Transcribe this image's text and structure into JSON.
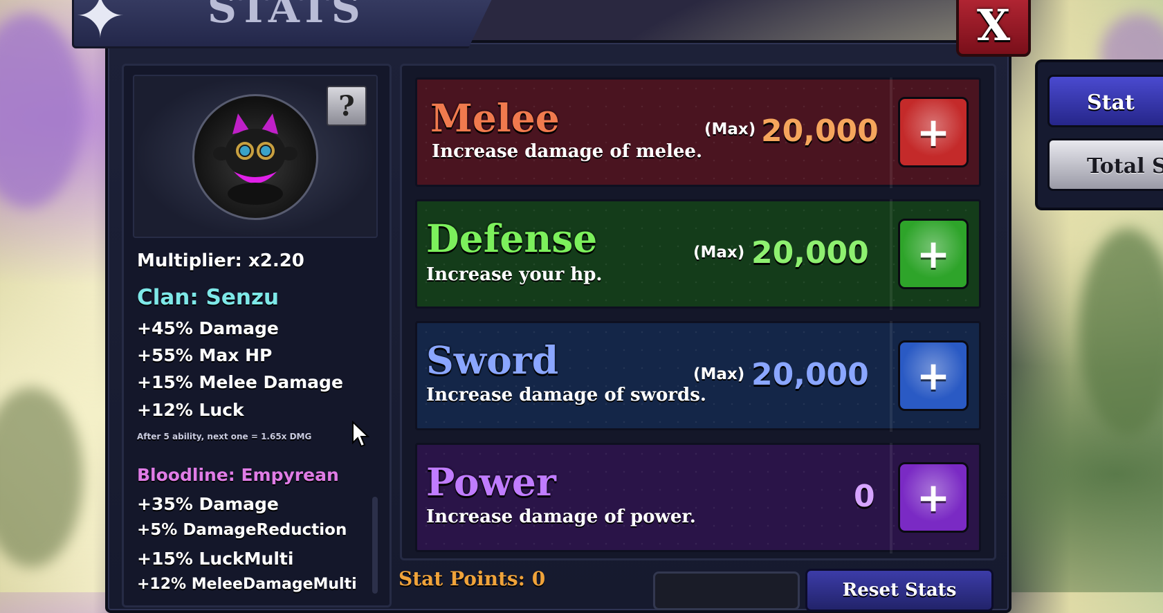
{
  "window": {
    "title": "STATS",
    "close_label": "X"
  },
  "profile": {
    "help_label": "?",
    "multiplier": "Multiplier: x2.20",
    "clan": {
      "title": "Clan: Senzu",
      "bonuses": [
        "+45% Damage",
        "+55% Max HP",
        "+15% Melee Damage",
        "+12% Luck"
      ],
      "note": "After 5 ability, next one = 1.65x DMG"
    },
    "bloodline": {
      "title": "Bloodline: Empyrean",
      "bonuses": [
        "+35% Damage",
        "+5% DamageReduction",
        "+15% LuckMulti",
        "+12% MeleeDamageMulti"
      ]
    }
  },
  "stats": [
    {
      "name": "Melee",
      "description": "Increase damage of melee.",
      "max_label": "(Max)",
      "value": "20,000",
      "color": "#f07a4e",
      "value_color": "#f5a55c",
      "button_color": "#c42a2a",
      "row_color": "#4a1420",
      "plus": "+"
    },
    {
      "name": "Defense",
      "description": "Increase your hp.",
      "max_label": "(Max)",
      "value": "20,000",
      "color": "#7cf05c",
      "value_color": "#8ef070",
      "button_color": "#2ea42a",
      "row_color": "#143c1a",
      "plus": "+"
    },
    {
      "name": "Sword",
      "description": "Increase damage of swords.",
      "max_label": "(Max)",
      "value": "20,000",
      "color": "#8aa6ff",
      "value_color": "#8aa6ff",
      "button_color": "#2a5ac4",
      "row_color": "#142648",
      "plus": "+"
    },
    {
      "name": "Power",
      "description": "Increase damage of power.",
      "max_label": "",
      "value": "0",
      "color": "#c07cff",
      "value_color": "#d6a4ff",
      "button_color": "#7a2ac4",
      "row_color": "#2a1448",
      "plus": "+"
    }
  ],
  "footer": {
    "stat_points": "Stat Points: 0",
    "reset_label": "Reset Stats"
  },
  "side_tabs": [
    {
      "label": "Stat"
    },
    {
      "label": "Total S"
    }
  ]
}
